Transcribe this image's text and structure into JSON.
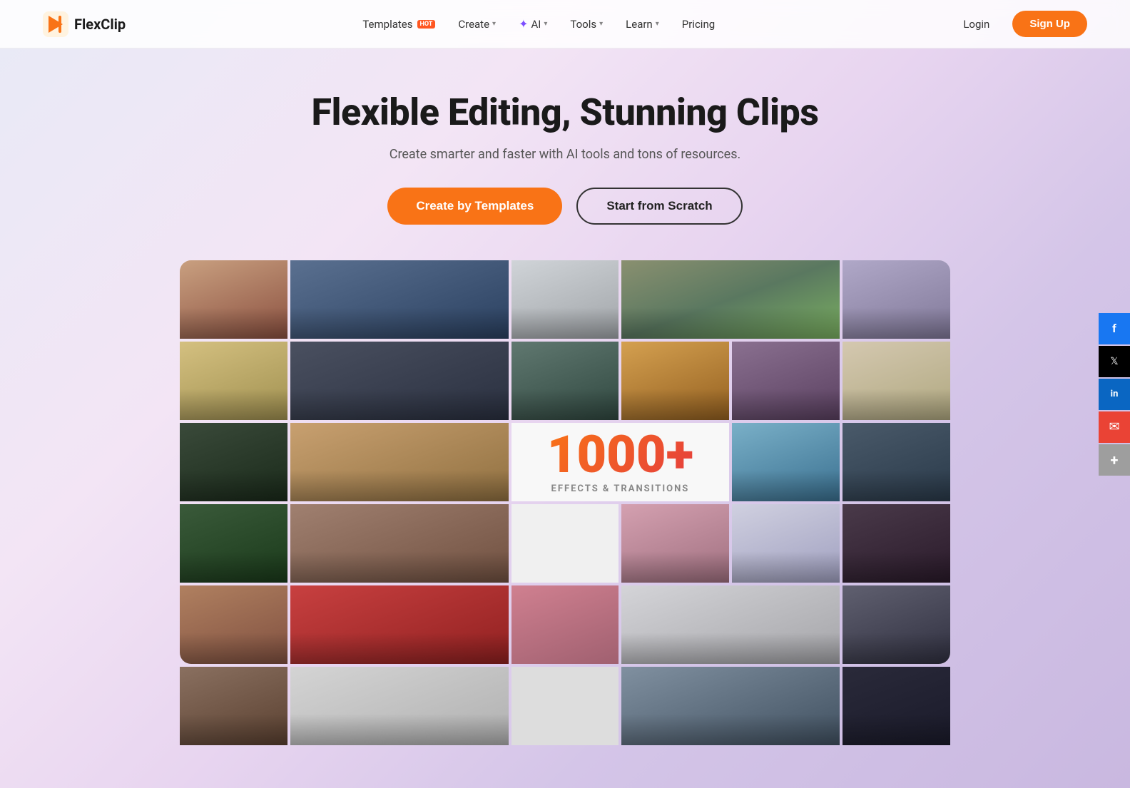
{
  "brand": {
    "name": "FlexClip",
    "logo_color": "#f97316"
  },
  "nav": {
    "templates_label": "Templates",
    "templates_hot": "HOT",
    "create_label": "Create",
    "ai_label": "AI",
    "tools_label": "Tools",
    "learn_label": "Learn",
    "pricing_label": "Pricing",
    "login_label": "Login",
    "signup_label": "Sign Up"
  },
  "hero": {
    "title": "Flexible Editing, Stunning Clips",
    "subtitle": "Create smarter and faster with AI tools and tons of resources.",
    "cta_templates": "Create by Templates",
    "cta_scratch": "Start from Scratch"
  },
  "overlay": {
    "number": "1000+",
    "text": "EFFECTS & TRANSITIONS"
  },
  "social": {
    "facebook": "f",
    "twitter": "𝕏",
    "linkedin": "in",
    "email": "✉",
    "more": "+"
  }
}
